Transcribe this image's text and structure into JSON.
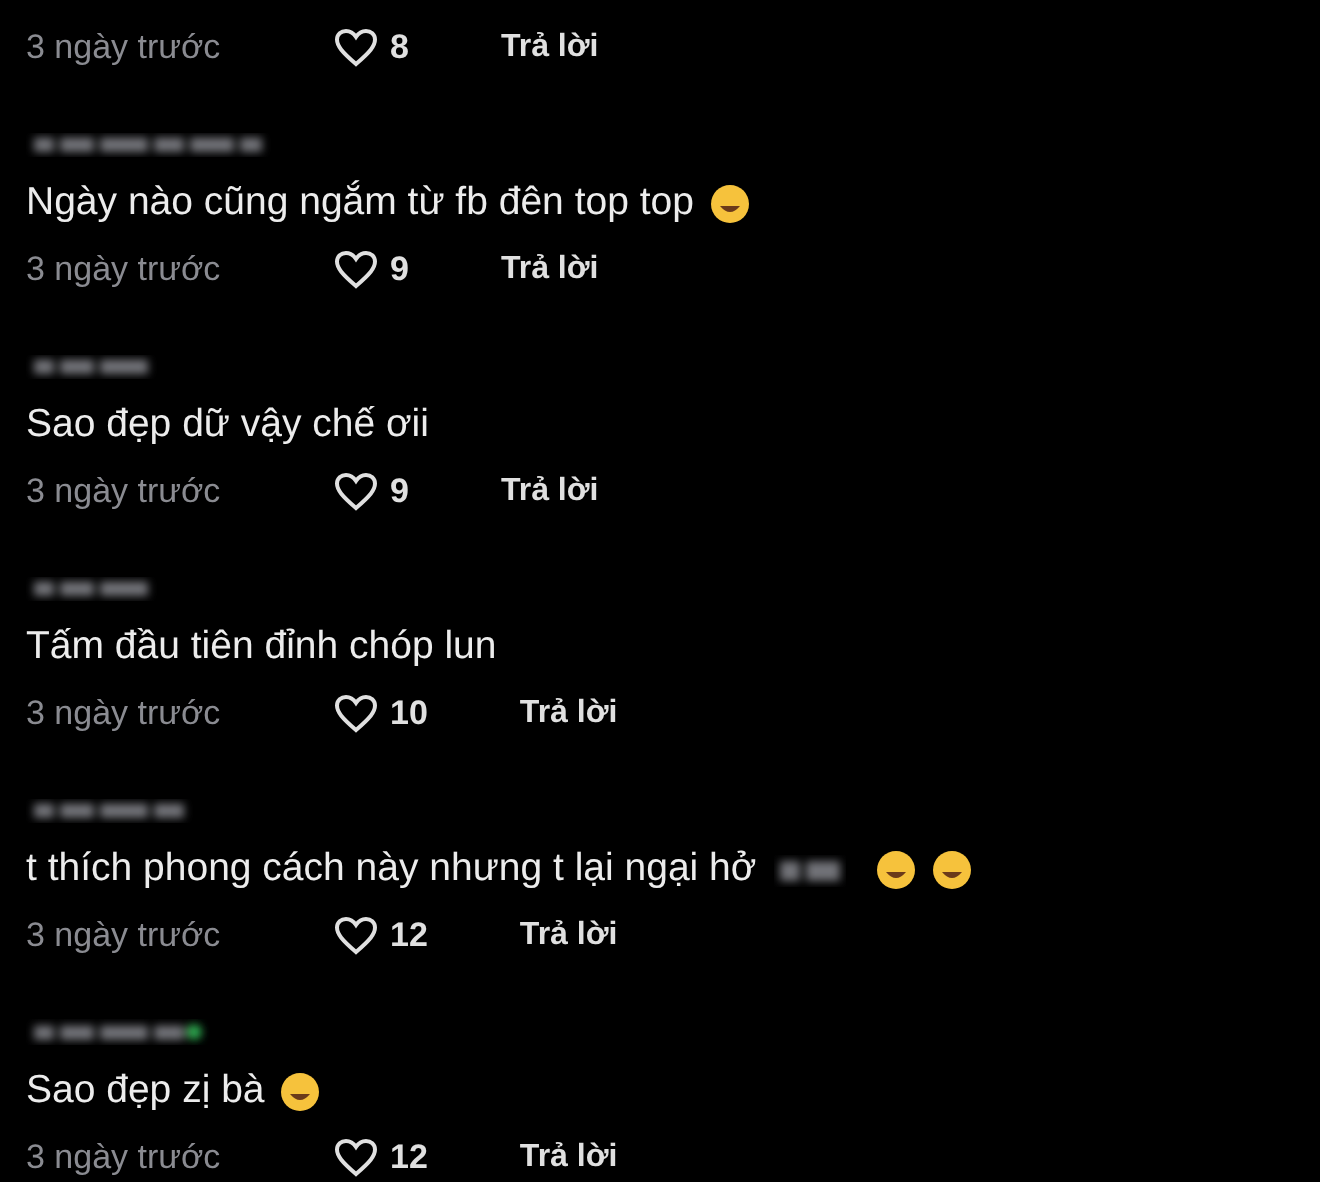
{
  "first_meta": {
    "time": "3 ngày trước",
    "likes": "8",
    "reply": "Trả lời"
  },
  "comments": [
    {
      "text": "Ngày nào cũng ngắm từ fb đên top top",
      "suffix": [
        {
          "kind": "emoji"
        }
      ],
      "time": "3 ngày trước",
      "likes": "9",
      "reply": "Trả lời"
    },
    {
      "text": "Sao đẹp dữ vậy chế ơii",
      "time": "3 ngày trước",
      "likes": "9",
      "reply": "Trả lời"
    },
    {
      "text": "Tấm đầu tiên đỉnh chóp lun",
      "time": "3 ngày trước",
      "likes": "10",
      "reply": "Trả lời"
    },
    {
      "text": "t thích phong cách này nhưng t lại ngại hở",
      "suffix": [
        {
          "kind": "blur"
        },
        {
          "kind": "emoji"
        },
        {
          "kind": "emoji"
        }
      ],
      "time": "3 ngày trước",
      "likes": "12",
      "reply": "Trả lời"
    },
    {
      "text": "Sao đẹp zị bà",
      "suffix": [
        {
          "kind": "emoji"
        }
      ],
      "time": "3 ngày trước",
      "likes": "12",
      "reply": "Trả lời"
    }
  ]
}
